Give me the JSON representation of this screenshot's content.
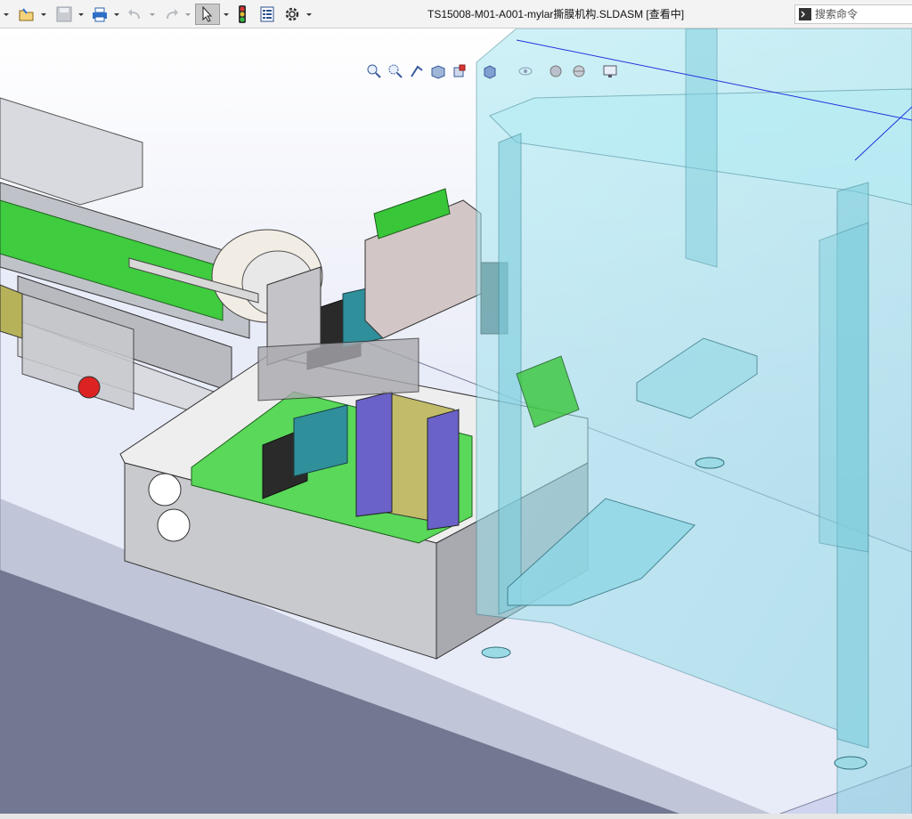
{
  "window": {
    "title": "TS15008-M01-A001-mylar撕膜机构.SLDASM [查看中]"
  },
  "toolbar": {
    "items": [
      {
        "icon": "menu-arrow-icon"
      },
      {
        "icon": "open-icon"
      },
      {
        "icon": "save-icon"
      },
      {
        "icon": "print-icon"
      },
      {
        "icon": "undo-icon"
      },
      {
        "icon": "redo-icon"
      },
      {
        "icon": "select-icon"
      },
      {
        "icon": "traffic-light-icon"
      },
      {
        "icon": "file-properties-icon"
      },
      {
        "icon": "options-gear-icon"
      }
    ]
  },
  "search": {
    "placeholder": "搜索命令"
  },
  "heads_up_toolbar": {
    "items": [
      "zoom-to-fit-icon",
      "zoom-to-area-icon",
      "previous-view-icon",
      "section-view-icon",
      "view-orientation-icon",
      "display-style-icon",
      "hide-show-icon",
      "edit-appearance-icon",
      "apply-scene-icon",
      "view-settings-icon"
    ]
  },
  "colors": {
    "toolbar_bg": "#f3f3f3",
    "viewport_top": "#ffffff",
    "viewport_bottom": "#d7dcf2",
    "floor": "#e7ebf8",
    "glass": "#8fd8e6",
    "accent_green": "#4fd24f"
  }
}
